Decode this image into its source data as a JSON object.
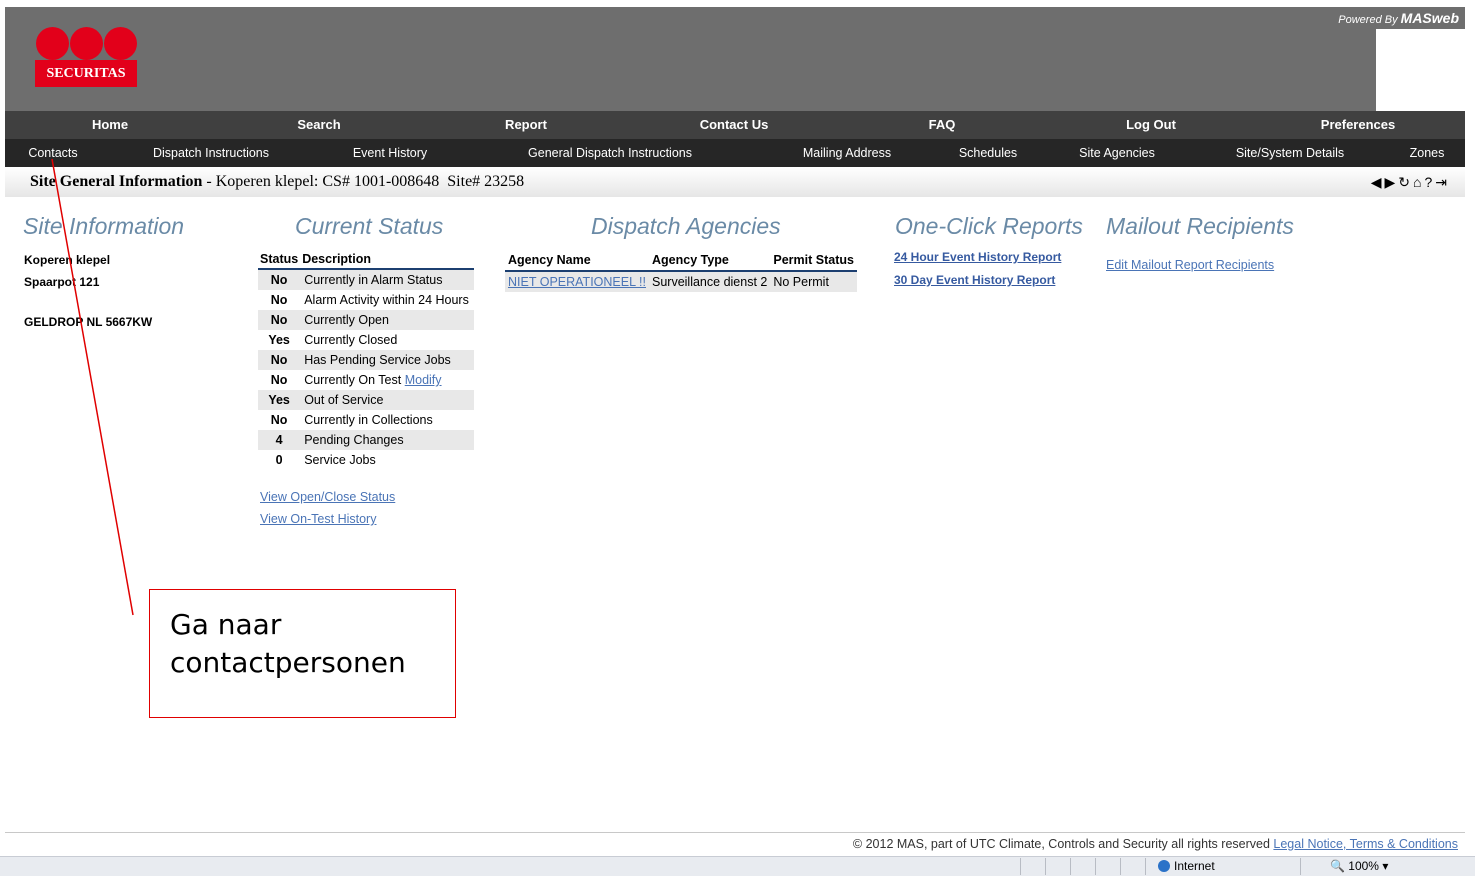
{
  "branding": {
    "logo_text": "SECURITAS",
    "powered_by_prefix": "Powered By",
    "powered_by_brand": "MASweb"
  },
  "nav_primary": [
    "Home",
    "Search",
    "Report",
    "Contact Us",
    "FAQ",
    "Log Out",
    "Preferences"
  ],
  "nav_secondary": [
    "Contacts",
    "Dispatch Instructions",
    "Event History",
    "General Dispatch Instructions",
    "Mailing Address",
    "Schedules",
    "Site Agencies",
    "Site/System Details",
    "Zones"
  ],
  "title_bar": {
    "heading": "Site General Information",
    "detail": " - Koperen klepel: CS# 1001-008648  Site# 23258"
  },
  "toolbar_icons": [
    "back-icon",
    "forward-icon",
    "refresh-icon",
    "home-icon",
    "help-icon",
    "exit-icon"
  ],
  "site_information": {
    "heading": "Site Information",
    "address_line1": "Koperen klepel",
    "address_line2": "Spaarpot 121",
    "address_line3": "GELDROP NL 5667KW"
  },
  "current_status": {
    "heading": "Current Status",
    "col_status": "Status",
    "col_description": "Description",
    "rows": [
      {
        "value": "No",
        "description": "Currently in Alarm Status"
      },
      {
        "value": "No",
        "description": "Alarm Activity within 24 Hours"
      },
      {
        "value": "No",
        "description": "Currently Open"
      },
      {
        "value": "Yes",
        "description": "Currently Closed"
      },
      {
        "value": "No",
        "description": "Has Pending Service Jobs"
      },
      {
        "value": "No",
        "description": "Currently On Test",
        "link": "Modify"
      },
      {
        "value": "Yes",
        "description": "Out of Service"
      },
      {
        "value": "No",
        "description": "Currently in Collections"
      },
      {
        "value": "4",
        "description": "Pending Changes"
      },
      {
        "value": "0",
        "description": "Service Jobs"
      }
    ],
    "link_open_close": "View Open/Close Status",
    "link_on_test": "View On-Test History"
  },
  "dispatch_agencies": {
    "heading": "Dispatch Agencies",
    "col_name": "Agency Name",
    "col_type": "Agency Type",
    "col_permit": "Permit Status",
    "rows": [
      {
        "name": "NIET OPERATIONEEL !!",
        "type": "Surveillance dienst 2",
        "permit": "No Permit"
      }
    ]
  },
  "one_click_reports": {
    "heading": "One-Click Reports",
    "link_24h": "24 Hour Event History Report",
    "link_30d": "30 Day Event History Report"
  },
  "mailout_recipients": {
    "heading": "Mailout Recipients",
    "link_edit": "Edit Mailout Report Recipients"
  },
  "annotation": {
    "line1": "Ga naar",
    "line2": "contactpersonen",
    "color": "#e00000"
  },
  "footer": {
    "copyright": "© 2012 MAS, part of UTC Climate, Controls and Security all rights reserved",
    "legal_link": "Legal Notice, Terms & Conditions"
  },
  "browser_status": {
    "zone": "Internet",
    "zoom": "100%"
  },
  "colors": {
    "header_bg": "#6e6e6e",
    "nav_primary_bg": "#404040",
    "nav_secondary_bg": "#262626",
    "brand_red": "#e2001a",
    "heading_blue": "#6a8aa6",
    "link_blue": "#4a74b6"
  }
}
